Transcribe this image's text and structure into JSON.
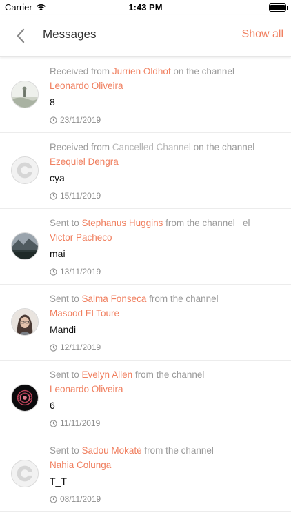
{
  "status_bar": {
    "carrier": "Carrier",
    "time": "1:43 PM"
  },
  "nav": {
    "title": "Messages",
    "show_all": "Show all"
  },
  "messages": [
    {
      "prefix": "Received from",
      "person": "Jurrien Oldhof",
      "middle": "on the channel",
      "channel": "Leonardo Oliveira",
      "text": "8",
      "date": "23/11/2019",
      "avatar": "landscape-mist"
    },
    {
      "prefix": "Received from",
      "person": "Cancelled Channel",
      "middle": "on the channel",
      "channel": "Ezequiel Dengra",
      "text": "cya",
      "date": "15/11/2019",
      "avatar": "default-logo"
    },
    {
      "prefix": "Sent to",
      "person": "Stephanus Huggins",
      "middle": "from the channel   el",
      "channel": "Victor Pacheco",
      "text": "mai",
      "date": "13/11/2019",
      "avatar": "mountain-lake"
    },
    {
      "prefix": "Sent to",
      "person": "Salma Fonseca",
      "middle": "from the channel",
      "channel": "Masood El Toure",
      "text": "Mandi",
      "date": "12/11/2019",
      "avatar": "portrait"
    },
    {
      "prefix": "Sent to",
      "person": "Evelyn Allen",
      "middle": "from the channel",
      "channel": "Leonardo Oliveira",
      "text": "6",
      "date": "11/11/2019",
      "avatar": "rose-art"
    },
    {
      "prefix": "Sent to",
      "person": "Sadou Mokaté",
      "middle": "from the channel",
      "channel": "Nahia Colunga",
      "text": "T_T",
      "date": "08/11/2019",
      "avatar": "default-logo"
    }
  ],
  "colors": {
    "accent": "#f07f5f",
    "muted": "#9a9a9a",
    "cancelled": "#b5b5b5"
  }
}
